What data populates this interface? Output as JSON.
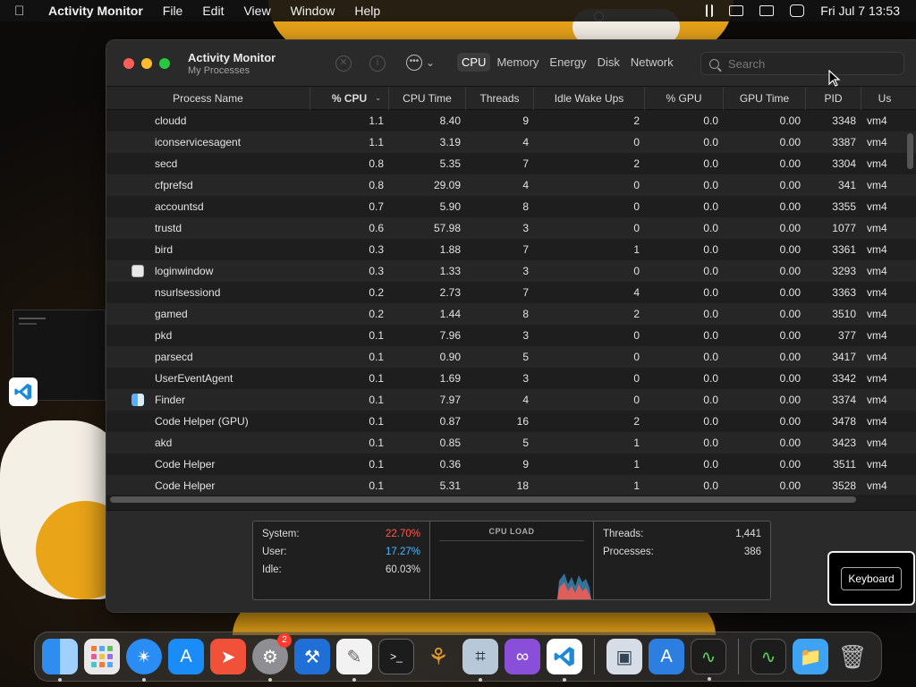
{
  "menubar": {
    "app_name": "Activity Monitor",
    "items": [
      "File",
      "Edit",
      "View",
      "Window",
      "Help"
    ],
    "datetime": "Fri Jul 7  13:53"
  },
  "window": {
    "title": "Activity Monitor",
    "subtitle": "My Processes",
    "tabs": [
      "CPU",
      "Memory",
      "Energy",
      "Disk",
      "Network"
    ],
    "active_tab": "CPU",
    "search_placeholder": "Search"
  },
  "table": {
    "columns": [
      "Process Name",
      "% CPU",
      "CPU Time",
      "Threads",
      "Idle Wake Ups",
      "% GPU",
      "GPU Time",
      "PID",
      "Us"
    ],
    "rows": [
      {
        "icon": "none",
        "name": "cloudd",
        "cpu": "1.1",
        "cpu_time": "8.40",
        "threads": "9",
        "idle": "2",
        "gpu": "0.0",
        "gpu_time": "0.00",
        "pid": "3348",
        "user": "vm4"
      },
      {
        "icon": "none",
        "name": "iconservicesagent",
        "cpu": "1.1",
        "cpu_time": "3.19",
        "threads": "4",
        "idle": "0",
        "gpu": "0.0",
        "gpu_time": "0.00",
        "pid": "3387",
        "user": "vm4"
      },
      {
        "icon": "none",
        "name": "secd",
        "cpu": "0.8",
        "cpu_time": "5.35",
        "threads": "7",
        "idle": "2",
        "gpu": "0.0",
        "gpu_time": "0.00",
        "pid": "3304",
        "user": "vm4"
      },
      {
        "icon": "none",
        "name": "cfprefsd",
        "cpu": "0.8",
        "cpu_time": "29.09",
        "threads": "4",
        "idle": "0",
        "gpu": "0.0",
        "gpu_time": "0.00",
        "pid": "341",
        "user": "vm4"
      },
      {
        "icon": "none",
        "name": "accountsd",
        "cpu": "0.7",
        "cpu_time": "5.90",
        "threads": "8",
        "idle": "0",
        "gpu": "0.0",
        "gpu_time": "0.00",
        "pid": "3355",
        "user": "vm4"
      },
      {
        "icon": "none",
        "name": "trustd",
        "cpu": "0.6",
        "cpu_time": "57.98",
        "threads": "3",
        "idle": "0",
        "gpu": "0.0",
        "gpu_time": "0.00",
        "pid": "1077",
        "user": "vm4"
      },
      {
        "icon": "none",
        "name": "bird",
        "cpu": "0.3",
        "cpu_time": "1.88",
        "threads": "7",
        "idle": "1",
        "gpu": "0.0",
        "gpu_time": "0.00",
        "pid": "3361",
        "user": "vm4"
      },
      {
        "icon": "loginwindow-icon",
        "name": "loginwindow",
        "cpu": "0.3",
        "cpu_time": "1.33",
        "threads": "3",
        "idle": "0",
        "gpu": "0.0",
        "gpu_time": "0.00",
        "pid": "3293",
        "user": "vm4"
      },
      {
        "icon": "none",
        "name": "nsurlsessiond",
        "cpu": "0.2",
        "cpu_time": "2.73",
        "threads": "7",
        "idle": "4",
        "gpu": "0.0",
        "gpu_time": "0.00",
        "pid": "3363",
        "user": "vm4"
      },
      {
        "icon": "none",
        "name": "gamed",
        "cpu": "0.2",
        "cpu_time": "1.44",
        "threads": "8",
        "idle": "2",
        "gpu": "0.0",
        "gpu_time": "0.00",
        "pid": "3510",
        "user": "vm4"
      },
      {
        "icon": "none",
        "name": "pkd",
        "cpu": "0.1",
        "cpu_time": "7.96",
        "threads": "3",
        "idle": "0",
        "gpu": "0.0",
        "gpu_time": "0.00",
        "pid": "377",
        "user": "vm4"
      },
      {
        "icon": "none",
        "name": "parsecd",
        "cpu": "0.1",
        "cpu_time": "0.90",
        "threads": "5",
        "idle": "0",
        "gpu": "0.0",
        "gpu_time": "0.00",
        "pid": "3417",
        "user": "vm4"
      },
      {
        "icon": "none",
        "name": "UserEventAgent",
        "cpu": "0.1",
        "cpu_time": "1.69",
        "threads": "3",
        "idle": "0",
        "gpu": "0.0",
        "gpu_time": "0.00",
        "pid": "3342",
        "user": "vm4"
      },
      {
        "icon": "finder-icon",
        "name": "Finder",
        "cpu": "0.1",
        "cpu_time": "7.97",
        "threads": "4",
        "idle": "0",
        "gpu": "0.0",
        "gpu_time": "0.00",
        "pid": "3374",
        "user": "vm4"
      },
      {
        "icon": "none",
        "name": "Code Helper (GPU)",
        "cpu": "0.1",
        "cpu_time": "0.87",
        "threads": "16",
        "idle": "2",
        "gpu": "0.0",
        "gpu_time": "0.00",
        "pid": "3478",
        "user": "vm4"
      },
      {
        "icon": "none",
        "name": "akd",
        "cpu": "0.1",
        "cpu_time": "0.85",
        "threads": "5",
        "idle": "1",
        "gpu": "0.0",
        "gpu_time": "0.00",
        "pid": "3423",
        "user": "vm4"
      },
      {
        "icon": "none",
        "name": "Code Helper",
        "cpu": "0.1",
        "cpu_time": "0.36",
        "threads": "9",
        "idle": "1",
        "gpu": "0.0",
        "gpu_time": "0.00",
        "pid": "3511",
        "user": "vm4"
      },
      {
        "icon": "none",
        "name": "Code Helper",
        "cpu": "0.1",
        "cpu_time": "5.31",
        "threads": "18",
        "idle": "1",
        "gpu": "0.0",
        "gpu_time": "0.00",
        "pid": "3528",
        "user": "vm4"
      }
    ]
  },
  "summary": {
    "system_label": "System:",
    "system_value": "22.70%",
    "user_label": "User:",
    "user_value": "17.27%",
    "idle_label": "Idle:",
    "idle_value": "60.03%",
    "cpu_load_label": "CPU LOAD",
    "threads_label": "Threads:",
    "threads_value": "1,441",
    "processes_label": "Processes:",
    "processes_value": "386",
    "colors": {
      "system": "#ff5a4f",
      "user": "#48b9ff"
    }
  },
  "keyboard_button": "Keyboard",
  "dock": {
    "apps": [
      "finder-icon",
      "launchpad-icon",
      "safari-icon",
      "app-store-icon",
      "swift-icon",
      "system-settings-icon",
      "xcode-icon",
      "textedit-icon",
      "terminal-icon",
      "instruments-icon",
      "graphing-icon",
      "visual-studio-icon",
      "vscode-icon",
      "preview-icon",
      "xcode-alt-icon",
      "activity-monitor-icon",
      "activity-monitor-alt-icon",
      "folder-icon",
      "trash-icon"
    ],
    "settings_badge": "2"
  }
}
